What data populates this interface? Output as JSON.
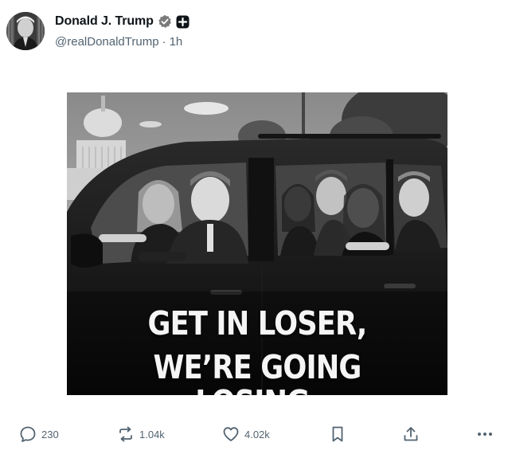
{
  "post": {
    "author": {
      "display_name": "Donald J. Trump",
      "handle": "@realDonaldTrump",
      "separator": "·",
      "time_ago": "1h",
      "verified_badge": "verified-check-icon",
      "plus_badge": "plus-square-icon"
    },
    "media": {
      "caption_line1": "GET IN LOSER,",
      "caption_line2": "WE’RE GOING LOSING.",
      "style": "black-and-white photo"
    },
    "actions": {
      "replies": "230",
      "reposts": "1.04k",
      "likes": "4.02k",
      "bookmark_icon": "bookmark-icon",
      "share_icon": "share-icon",
      "more_icon": "more-dots-icon"
    }
  },
  "colors": {
    "text_primary": "#0f1419",
    "text_secondary": "#536471",
    "background": "#ffffff"
  }
}
